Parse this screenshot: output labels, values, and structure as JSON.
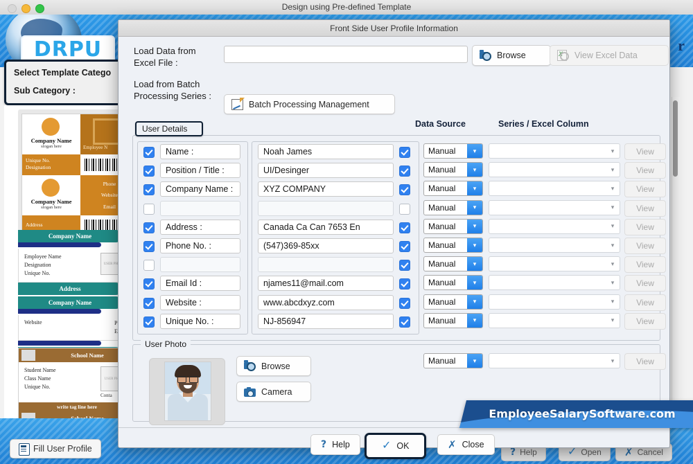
{
  "app": {
    "window_title": "Design using Pre-defined Template",
    "logo_text": "DRPU",
    "banner_right_partial": "r",
    "category_label": "Select Template Catego",
    "subcategory_label": "Sub Category :",
    "fill_user_profile": "Fill User Profile",
    "bottom_buttons": [
      {
        "label": "Help",
        "icon": "question-icon"
      },
      {
        "label": "Open",
        "icon": "open-icon"
      },
      {
        "label": "Cancel",
        "icon": "cancel-icon"
      }
    ],
    "templates": [
      {
        "id": "template-orange-corporate",
        "company_name": "Company Name",
        "slogan": "slogan here",
        "employee_name": "Employee N",
        "unique_no": "Unique No.",
        "designation": "Designation",
        "phone": "Phone",
        "website": "Website",
        "email": "Email",
        "address": "Address"
      },
      {
        "id": "template-teal-corporate",
        "company_name": "Company Name",
        "employee_name": "Employee Name",
        "designation": "Designation",
        "unique_no": "Unique No.",
        "address": "Address",
        "photo_placeholder": "USER PHOTO",
        "website": "Website",
        "phone": "Phone",
        "email": "Email"
      },
      {
        "id": "template-brown-school",
        "school_name": "School Name",
        "student_name": "Student Name",
        "class_name": "Class Name",
        "unique_no": "Unique No.",
        "photo_placeholder": "USER PHOTO",
        "contact": "Conta",
        "tag_line": "write tag line here"
      }
    ]
  },
  "dialog": {
    "title": "Front Side User Profile Information",
    "excel_label": "Load Data from Excel File :",
    "excel_value": "",
    "browse_excel_label": "Browse",
    "view_excel_label": "View Excel Data",
    "batch_label": "Load from Batch Processing Series :",
    "batch_button_label": "Batch Processing Management",
    "tab_label": "User Details",
    "column_headers": {
      "data_source": "Data Source",
      "series_excel_column": "Series / Excel Column"
    },
    "rows": [
      {
        "checked_left": true,
        "label": "Name :",
        "checked_right": true,
        "value": "Noah James",
        "data_source": "Manual",
        "series": "",
        "view": "View"
      },
      {
        "checked_left": true,
        "label": "Position / Title :",
        "checked_right": true,
        "value": "UI/Desinger",
        "data_source": "Manual",
        "series": "",
        "view": "View"
      },
      {
        "checked_left": true,
        "label": "Company Name :",
        "checked_right": true,
        "value": "XYZ COMPANY",
        "data_source": "Manual",
        "series": "",
        "view": "View"
      },
      {
        "checked_left": false,
        "label": "",
        "checked_right": false,
        "value": "",
        "data_source": "Manual",
        "series": "",
        "view": "View"
      },
      {
        "checked_left": true,
        "label": "Address :",
        "checked_right": true,
        "value": "Canada Ca Can 7653 En",
        "data_source": "Manual",
        "series": "",
        "view": "View"
      },
      {
        "checked_left": true,
        "label": "Phone No. :",
        "checked_right": true,
        "value": "(547)369-85xx",
        "data_source": "Manual",
        "series": "",
        "view": "View"
      },
      {
        "checked_left": false,
        "label": "",
        "checked_right": true,
        "value": "",
        "data_source": "Manual",
        "series": "",
        "view": "View"
      },
      {
        "checked_left": true,
        "label": "Email Id :",
        "checked_right": true,
        "value": "njames11@mail.com",
        "data_source": "Manual",
        "series": "",
        "view": "View"
      },
      {
        "checked_left": true,
        "label": "Website :",
        "checked_right": true,
        "value": "www.abcdxyz.com",
        "data_source": "Manual",
        "series": "",
        "view": "View"
      },
      {
        "checked_left": true,
        "label": "Unique No. :",
        "checked_right": true,
        "value": "NJ-856947",
        "data_source": "Manual",
        "series": "",
        "view": "View"
      }
    ],
    "photo_group": {
      "legend": "User Photo",
      "browse_label": "Browse",
      "camera_label": "Camera",
      "data_source": "Manual",
      "series": "",
      "view": "View"
    },
    "footer": {
      "help_label": "Help",
      "ok_label": "OK",
      "close_label": "Close"
    }
  },
  "watermark": {
    "text": "EmployeeSalarySoftware.com"
  },
  "colors": {
    "accent_blue": "#2d9ae8",
    "checkbox_blue": "#3081f0",
    "focus_ring": "#0e1f33",
    "watermark_navy": "#1b4e8e"
  }
}
